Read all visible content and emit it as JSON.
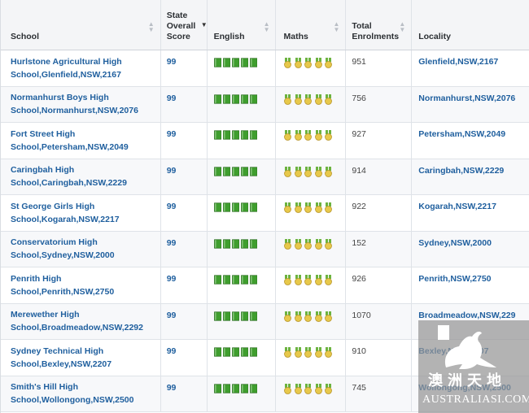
{
  "columns": {
    "school": "School",
    "score": "State\nOverall\nScore",
    "english": "English",
    "maths": "Maths",
    "enrolments": "Total\nEnrolments",
    "locality": "Locality"
  },
  "ratings": {
    "english_books": 5,
    "maths_medals": 5,
    "book_color": "#3f9e2e",
    "medal_color": "#e7c84a",
    "medal_ribbon": "#6cb33f"
  },
  "rows": [
    {
      "school_line1": "Hurlstone Agricultural High",
      "school_line2": "School,Glenfield,NSW,2167",
      "score": "99",
      "enrolments": "951",
      "locality": "Glenfield,NSW,2167"
    },
    {
      "school_line1": "Normanhurst Boys High",
      "school_line2": "School,Normanhurst,NSW,2076",
      "score": "99",
      "enrolments": "756",
      "locality": "Normanhurst,NSW,2076"
    },
    {
      "school_line1": "Fort Street High",
      "school_line2": "School,Petersham,NSW,2049",
      "score": "99",
      "enrolments": "927",
      "locality": "Petersham,NSW,2049"
    },
    {
      "school_line1": "Caringbah High",
      "school_line2": "School,Caringbah,NSW,2229",
      "score": "99",
      "enrolments": "914",
      "locality": "Caringbah,NSW,2229"
    },
    {
      "school_line1": "St George Girls High",
      "school_line2": "School,Kogarah,NSW,2217",
      "score": "99",
      "enrolments": "922",
      "locality": "Kogarah,NSW,2217"
    },
    {
      "school_line1": "Conservatorium High",
      "school_line2": "School,Sydney,NSW,2000",
      "score": "99",
      "enrolments": "152",
      "locality": "Sydney,NSW,2000"
    },
    {
      "school_line1": "Penrith High",
      "school_line2": "School,Penrith,NSW,2750",
      "score": "99",
      "enrolments": "926",
      "locality": "Penrith,NSW,2750"
    },
    {
      "school_line1": "Merewether High",
      "school_line2": "School,Broadmeadow,NSW,2292",
      "score": "99",
      "enrolments": "1070",
      "locality": "Broadmeadow,NSW,229"
    },
    {
      "school_line1": "Sydney Technical High",
      "school_line2": "School,Bexley,NSW,2207",
      "score": "99",
      "enrolments": "910",
      "locality": "Bexley,NSW,2207"
    },
    {
      "school_line1": "Smith's Hill High",
      "school_line2": "School,Wollongong,NSW,2500",
      "score": "99",
      "enrolments": "745",
      "locality": "Wollongong,NSW,2500"
    }
  ],
  "watermark": {
    "cn": "澳洲天地",
    "en": "AUSTRALIASI.COM"
  }
}
